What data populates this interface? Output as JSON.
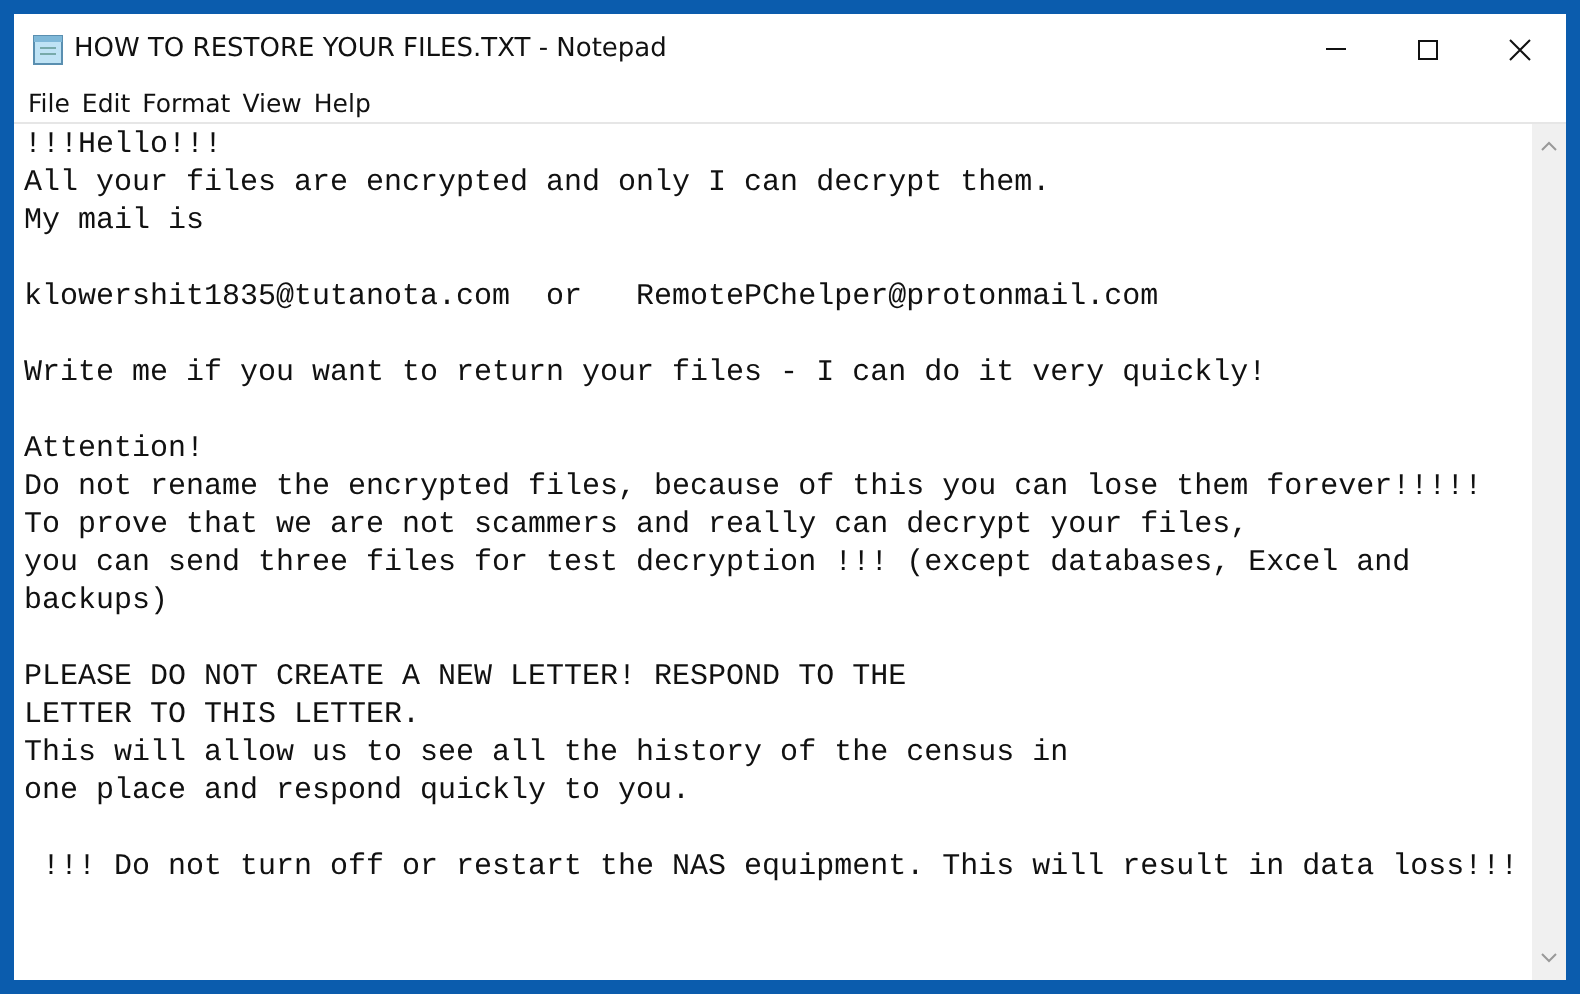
{
  "window": {
    "title": "HOW TO RESTORE YOUR FILES.TXT - Notepad"
  },
  "menu": [
    "File",
    "Edit",
    "Format",
    "View",
    "Help"
  ],
  "document": {
    "paragraphs": [
      [
        "!!!Hello!!!",
        "All your files are encrypted and only I can decrypt them.",
        "My mail is"
      ],
      [
        "klowershit1835@tutanota.com  or   RemotePChelper@protonmail.com"
      ],
      [
        "Write me if you want to return your files - I can do it very quickly!"
      ],
      [
        "Attention!",
        "Do not rename the encrypted files, because of this you can lose them forever!!!!!",
        "To prove that we are not scammers and really can decrypt your files,",
        "you can send three files for test decryption !!! (except databases, Excel and",
        "backups)"
      ],
      [
        "PLEASE DO NOT CREATE A NEW LETTER! RESPOND TO THE",
        "LETTER TO THIS LETTER.",
        "This will allow us to see all the history of the census in",
        "one place and respond quickly to you."
      ],
      [
        " !!! Do not turn off or restart the NAS equipment. This will result in data loss!!!"
      ]
    ]
  }
}
